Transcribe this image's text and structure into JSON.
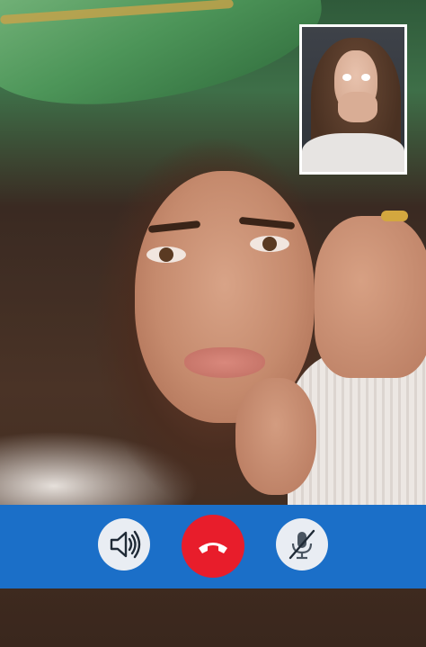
{
  "call": {
    "remote_video": {
      "description_icon": "remote-camera-feed"
    },
    "self_view": {
      "icon": "self-camera-feed"
    }
  },
  "controls": [
    {
      "id": "speaker",
      "icon": "speaker-icon",
      "color": "#e9edf3"
    },
    {
      "id": "end_call",
      "icon": "phone-hangup-icon",
      "color": "#e81d2b"
    },
    {
      "id": "mute",
      "icon": "mic-off-icon",
      "color": "#e9edf3"
    }
  ],
  "colors": {
    "call_bar": "#1b6fc8",
    "end_call": "#e81d2b",
    "control_bg": "#e9edf3",
    "self_view_border": "#ffffff"
  }
}
